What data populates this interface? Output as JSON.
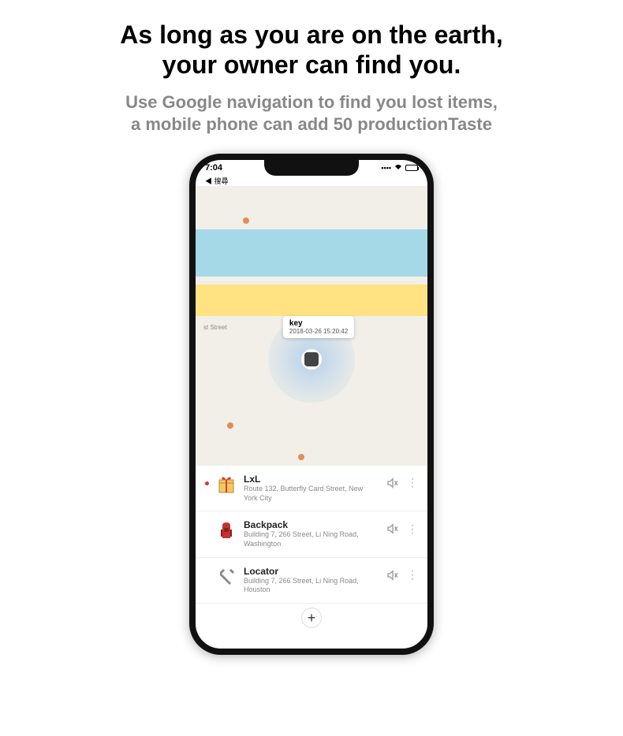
{
  "headline_l1": "As long as you are on the earth,",
  "headline_l2": "your owner can find you.",
  "sub_l1": "Use Google navigation to find you lost items,",
  "sub_l2": "a mobile phone can add 50 productionTaste",
  "status": {
    "time": "7:04",
    "back": "◀ 搜尋"
  },
  "callout": {
    "title": "key",
    "timestamp": "2018-03-26 15:20:42"
  },
  "items": [
    {
      "title": "LxL",
      "addr": "Route 132, Butterfly Card Street, New York City",
      "dot": true,
      "icon": "gift"
    },
    {
      "title": "Backpack",
      "addr": "Building 7, 266 Street, Li Ning Road, Washington",
      "dot": false,
      "icon": "backpack"
    },
    {
      "title": "Locator",
      "addr": "Building 7, 266 Street, Li Ning Road, Houston",
      "dot": false,
      "icon": "tools"
    }
  ],
  "add_label": "+"
}
